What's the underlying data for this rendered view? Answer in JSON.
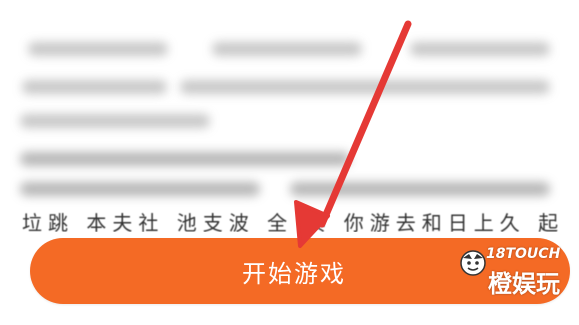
{
  "page": {
    "background": "#ffffff"
  },
  "content": {
    "blurred": true,
    "cut_text": "垃跳 本夫社 池支波 全 典 你游去和日上久 起"
  },
  "start_button": {
    "label": "开始游戏",
    "color": "#f46a25",
    "text_color": "#ffffff"
  },
  "annotation": {
    "type": "arrow",
    "color": "#e53935",
    "points_to": "start-button"
  },
  "watermark": {
    "latin": "18TOUCH",
    "chinese": "橙娱玩",
    "icon": "cartoon-face-logo"
  }
}
